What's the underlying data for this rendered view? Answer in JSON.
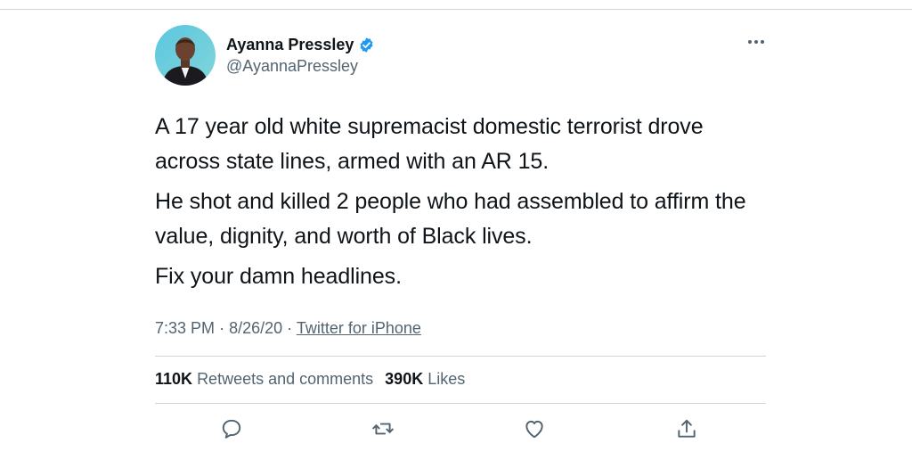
{
  "author": {
    "display_name": "Ayanna Pressley",
    "handle": "@AyannaPressley",
    "verified": true,
    "verified_color": "#1d9bf0"
  },
  "tweet": {
    "paragraphs": [
      "A 17 year old white supremacist domestic terrorist drove across state lines, armed with an AR 15.",
      "He shot and killed 2 people who had assembled to affirm the value, dignity, and worth of Black lives.",
      "Fix your damn headlines."
    ],
    "time": "7:33 PM",
    "separator": "·",
    "date": "8/26/20",
    "source": "Twitter for iPhone"
  },
  "stats": {
    "retweets_count": "110K",
    "retweets_label": "Retweets and comments",
    "likes_count": "390K",
    "likes_label": "Likes"
  },
  "icons": {
    "more": "more-options-icon",
    "reply": "reply-icon",
    "retweet": "retweet-icon",
    "like": "heart-icon",
    "share": "share-icon"
  }
}
